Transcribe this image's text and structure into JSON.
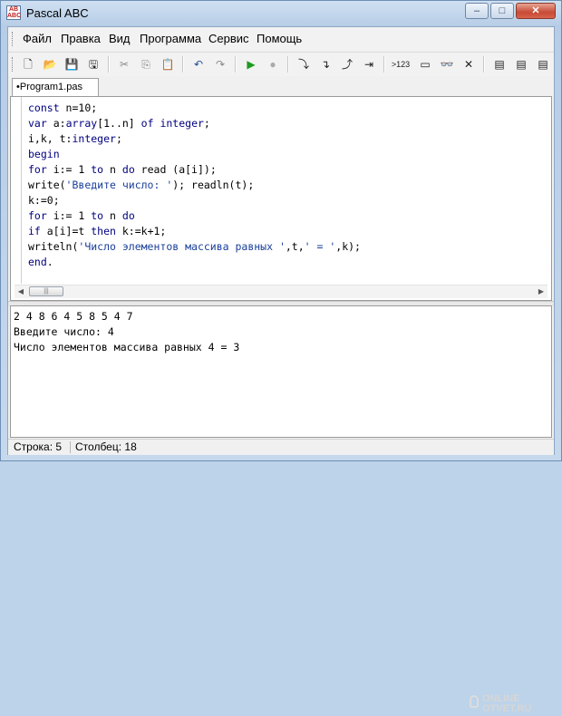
{
  "window": {
    "title": "Pascal ABC",
    "icon_text": "AB\nABC",
    "close_label": "✕",
    "min_label": "–",
    "max_label": "□"
  },
  "menu": [
    "Файл",
    "Правка",
    "Вид",
    "Программа",
    "Сервис",
    "Помощь"
  ],
  "toolbar": {
    "buttons": [
      {
        "name": "new-file",
        "glyph": "🗋"
      },
      {
        "name": "open-file",
        "glyph": "📂"
      },
      {
        "name": "save",
        "glyph": "💾"
      },
      {
        "name": "save-all",
        "glyph": "🖫"
      },
      {
        "name": "cut",
        "glyph": "✂"
      },
      {
        "name": "copy",
        "glyph": "⎘"
      },
      {
        "name": "paste",
        "glyph": "📋"
      },
      {
        "name": "undo",
        "glyph": "↶"
      },
      {
        "name": "redo",
        "glyph": "↷"
      },
      {
        "name": "run",
        "glyph": "▶"
      },
      {
        "name": "stop",
        "glyph": "●"
      },
      {
        "name": "step-into",
        "glyph": "⤵"
      },
      {
        "name": "step-over",
        "glyph": "↴"
      },
      {
        "name": "step-out",
        "glyph": "⤴"
      },
      {
        "name": "run-to-cursor",
        "glyph": "⇥"
      },
      {
        "name": "format",
        "glyph": ">123"
      },
      {
        "name": "window",
        "glyph": "▭"
      },
      {
        "name": "watch",
        "glyph": "👓"
      },
      {
        "name": "clear",
        "glyph": "✕"
      },
      {
        "name": "tool-1",
        "glyph": "▤"
      },
      {
        "name": "tool-2",
        "glyph": "▤"
      },
      {
        "name": "tool-3",
        "glyph": "▤"
      }
    ]
  },
  "tab": {
    "label": "•Program1.pas"
  },
  "editor": {
    "lines": [
      [
        {
          "t": "const",
          "c": "kw"
        },
        {
          "t": " n=10;",
          "c": ""
        }
      ],
      [
        {
          "t": "var",
          "c": "kw"
        },
        {
          "t": " a:",
          "c": ""
        },
        {
          "t": "array",
          "c": "kw"
        },
        {
          "t": "[1..n] ",
          "c": ""
        },
        {
          "t": "of",
          "c": "kw"
        },
        {
          "t": " ",
          "c": ""
        },
        {
          "t": "integer",
          "c": "kw"
        },
        {
          "t": ";",
          "c": ""
        }
      ],
      [
        {
          "t": "i,k, t:",
          "c": ""
        },
        {
          "t": "integer",
          "c": "kw"
        },
        {
          "t": ";",
          "c": ""
        }
      ],
      [
        {
          "t": "begin",
          "c": "kw"
        }
      ],
      [
        {
          "t": "for",
          "c": "kw"
        },
        {
          "t": " i:= 1 ",
          "c": ""
        },
        {
          "t": "to",
          "c": "kw"
        },
        {
          "t": " n ",
          "c": ""
        },
        {
          "t": "do",
          "c": "kw"
        },
        {
          "t": " read (a[i]);",
          "c": ""
        }
      ],
      [
        {
          "t": "write(",
          "c": ""
        },
        {
          "t": "'Введите число: '",
          "c": "str"
        },
        {
          "t": "); readln(t);",
          "c": ""
        }
      ],
      [
        {
          "t": "k:=0;",
          "c": ""
        }
      ],
      [
        {
          "t": "for",
          "c": "kw"
        },
        {
          "t": " i:= 1 ",
          "c": ""
        },
        {
          "t": "to",
          "c": "kw"
        },
        {
          "t": " n ",
          "c": ""
        },
        {
          "t": "do",
          "c": "kw"
        }
      ],
      [
        {
          "t": "if",
          "c": "kw"
        },
        {
          "t": " a[i]=t ",
          "c": ""
        },
        {
          "t": "then",
          "c": "kw"
        },
        {
          "t": " k:=k+1;",
          "c": ""
        }
      ],
      [
        {
          "t": "writeln(",
          "c": ""
        },
        {
          "t": "'Число элементов массива равных '",
          "c": "str"
        },
        {
          "t": ",t,",
          "c": ""
        },
        {
          "t": "' = '",
          "c": "str"
        },
        {
          "t": ",k);",
          "c": ""
        }
      ],
      [
        {
          "t": "end",
          "c": "kw"
        },
        {
          "t": ".",
          "c": ""
        }
      ]
    ]
  },
  "output": {
    "lines": [
      "2 4 8 6 4 5 8 5 4 7",
      "Введите число: 4",
      "Число элементов массива равных 4 = 3"
    ]
  },
  "watermark": {
    "line1": "ONLINE",
    "line2": "OTVET.RU"
  },
  "status": {
    "row": "Строка: 5",
    "col": "Столбец: 18"
  }
}
